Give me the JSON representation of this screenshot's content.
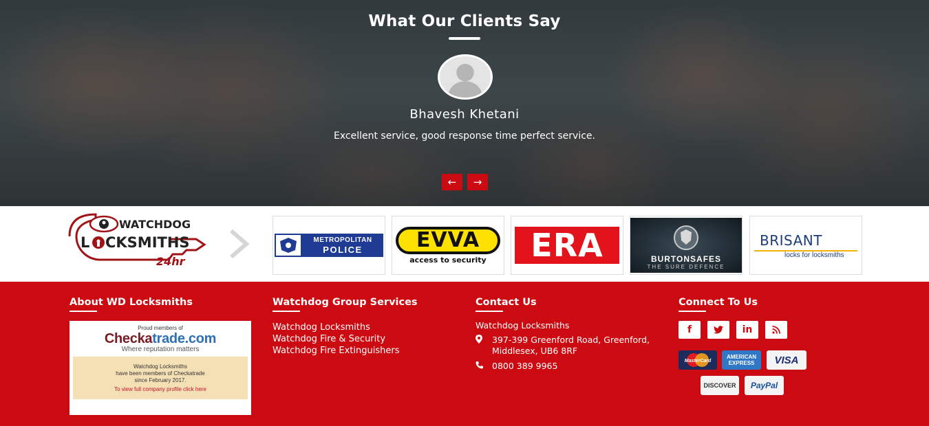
{
  "testimonials": {
    "title": "What Our Clients Say",
    "client_name": "Bhavesh Khetani",
    "quote": "Excellent service, good response time perfect service.",
    "prev_label": "←",
    "next_label": "→"
  },
  "logos": {
    "watchdog": {
      "line1": "WATCHDOG",
      "line2_a": "L",
      "line2_b": "CKSMITHS",
      "tag": "24hr"
    },
    "metpolice": {
      "line1": "METROPOLITAN",
      "line2": "POLICE"
    },
    "evva": {
      "name": "EVVA",
      "tagline": "access to security"
    },
    "era": {
      "name": "ERA"
    },
    "burton": {
      "name": "BURTONSAFES",
      "tagline": "THE SURE DEFENCE"
    },
    "brisant": {
      "name": "BRISANT",
      "tagline": "locks for locksmiths"
    }
  },
  "footer": {
    "about": {
      "heading": "About WD Locksmiths",
      "checkatrade": {
        "proud": "Proud members of",
        "brand_a": "Checka",
        "brand_b": "trade.com",
        "slogan": "Where reputation matters",
        "line1": "Watchdog Locksmiths",
        "line2": "have been members of Checkatrade",
        "line3": "since February 2017.",
        "link": "To view full company profile click here"
      }
    },
    "services": {
      "heading": "Watchdog Group Services",
      "links": [
        "Watchdog Locksmiths",
        "Watchdog Fire & Security",
        "Watchdog Fire Extinguishers"
      ]
    },
    "contact": {
      "heading": "Contact Us",
      "company": "Watchdog Locksmiths",
      "address_line1": "397-399 Greenford Road, Greenford,",
      "address_line2": "Middlesex, UB6 8RF",
      "phone": "0800 389 9965"
    },
    "connect": {
      "heading": "Connect To Us",
      "social": [
        {
          "icon": "facebook-icon",
          "glyph": "f"
        },
        {
          "icon": "twitter-icon",
          "glyph": "t"
        },
        {
          "icon": "linkedin-icon",
          "glyph": "in"
        },
        {
          "icon": "rss-icon",
          "glyph": ")"
        }
      ],
      "payments": {
        "mastercard": "MasterCard",
        "amex_1": "AMERICAN",
        "amex_2": "EXPRESS",
        "visa": "VISA",
        "discover": "DISCOVER",
        "paypal": "PayPal"
      }
    }
  },
  "colors": {
    "brand_red": "#cc0a12",
    "white": "#ffffff"
  }
}
